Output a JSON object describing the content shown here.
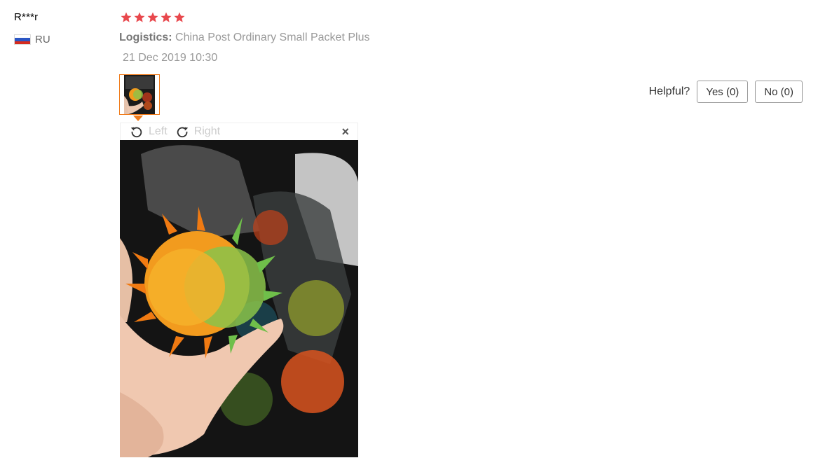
{
  "review": {
    "user_name": "R***r",
    "country_code": "RU",
    "rating": 5,
    "logistics_label": "Logistics:",
    "logistics_value": "China Post Ordinary Small Packet Plus",
    "date": "21 Dec 2019 10:30"
  },
  "viewer": {
    "rotate_left_label": "Left",
    "rotate_right_label": "Right",
    "close_symbol": "×"
  },
  "helpful": {
    "label": "Helpful?",
    "yes_label": "Yes (0)",
    "no_label": "No (0)"
  },
  "colors": {
    "star": "#e8484d",
    "thumb_border": "#f07c1c",
    "flag_white": "#ffffff",
    "flag_blue": "#2b56c4",
    "flag_red": "#d52b1e"
  },
  "icons": {
    "star": "star-icon",
    "rotate_left": "rotate-left-icon",
    "rotate_right": "rotate-right-icon",
    "close": "close-icon",
    "flag": "flag-ru-icon"
  }
}
